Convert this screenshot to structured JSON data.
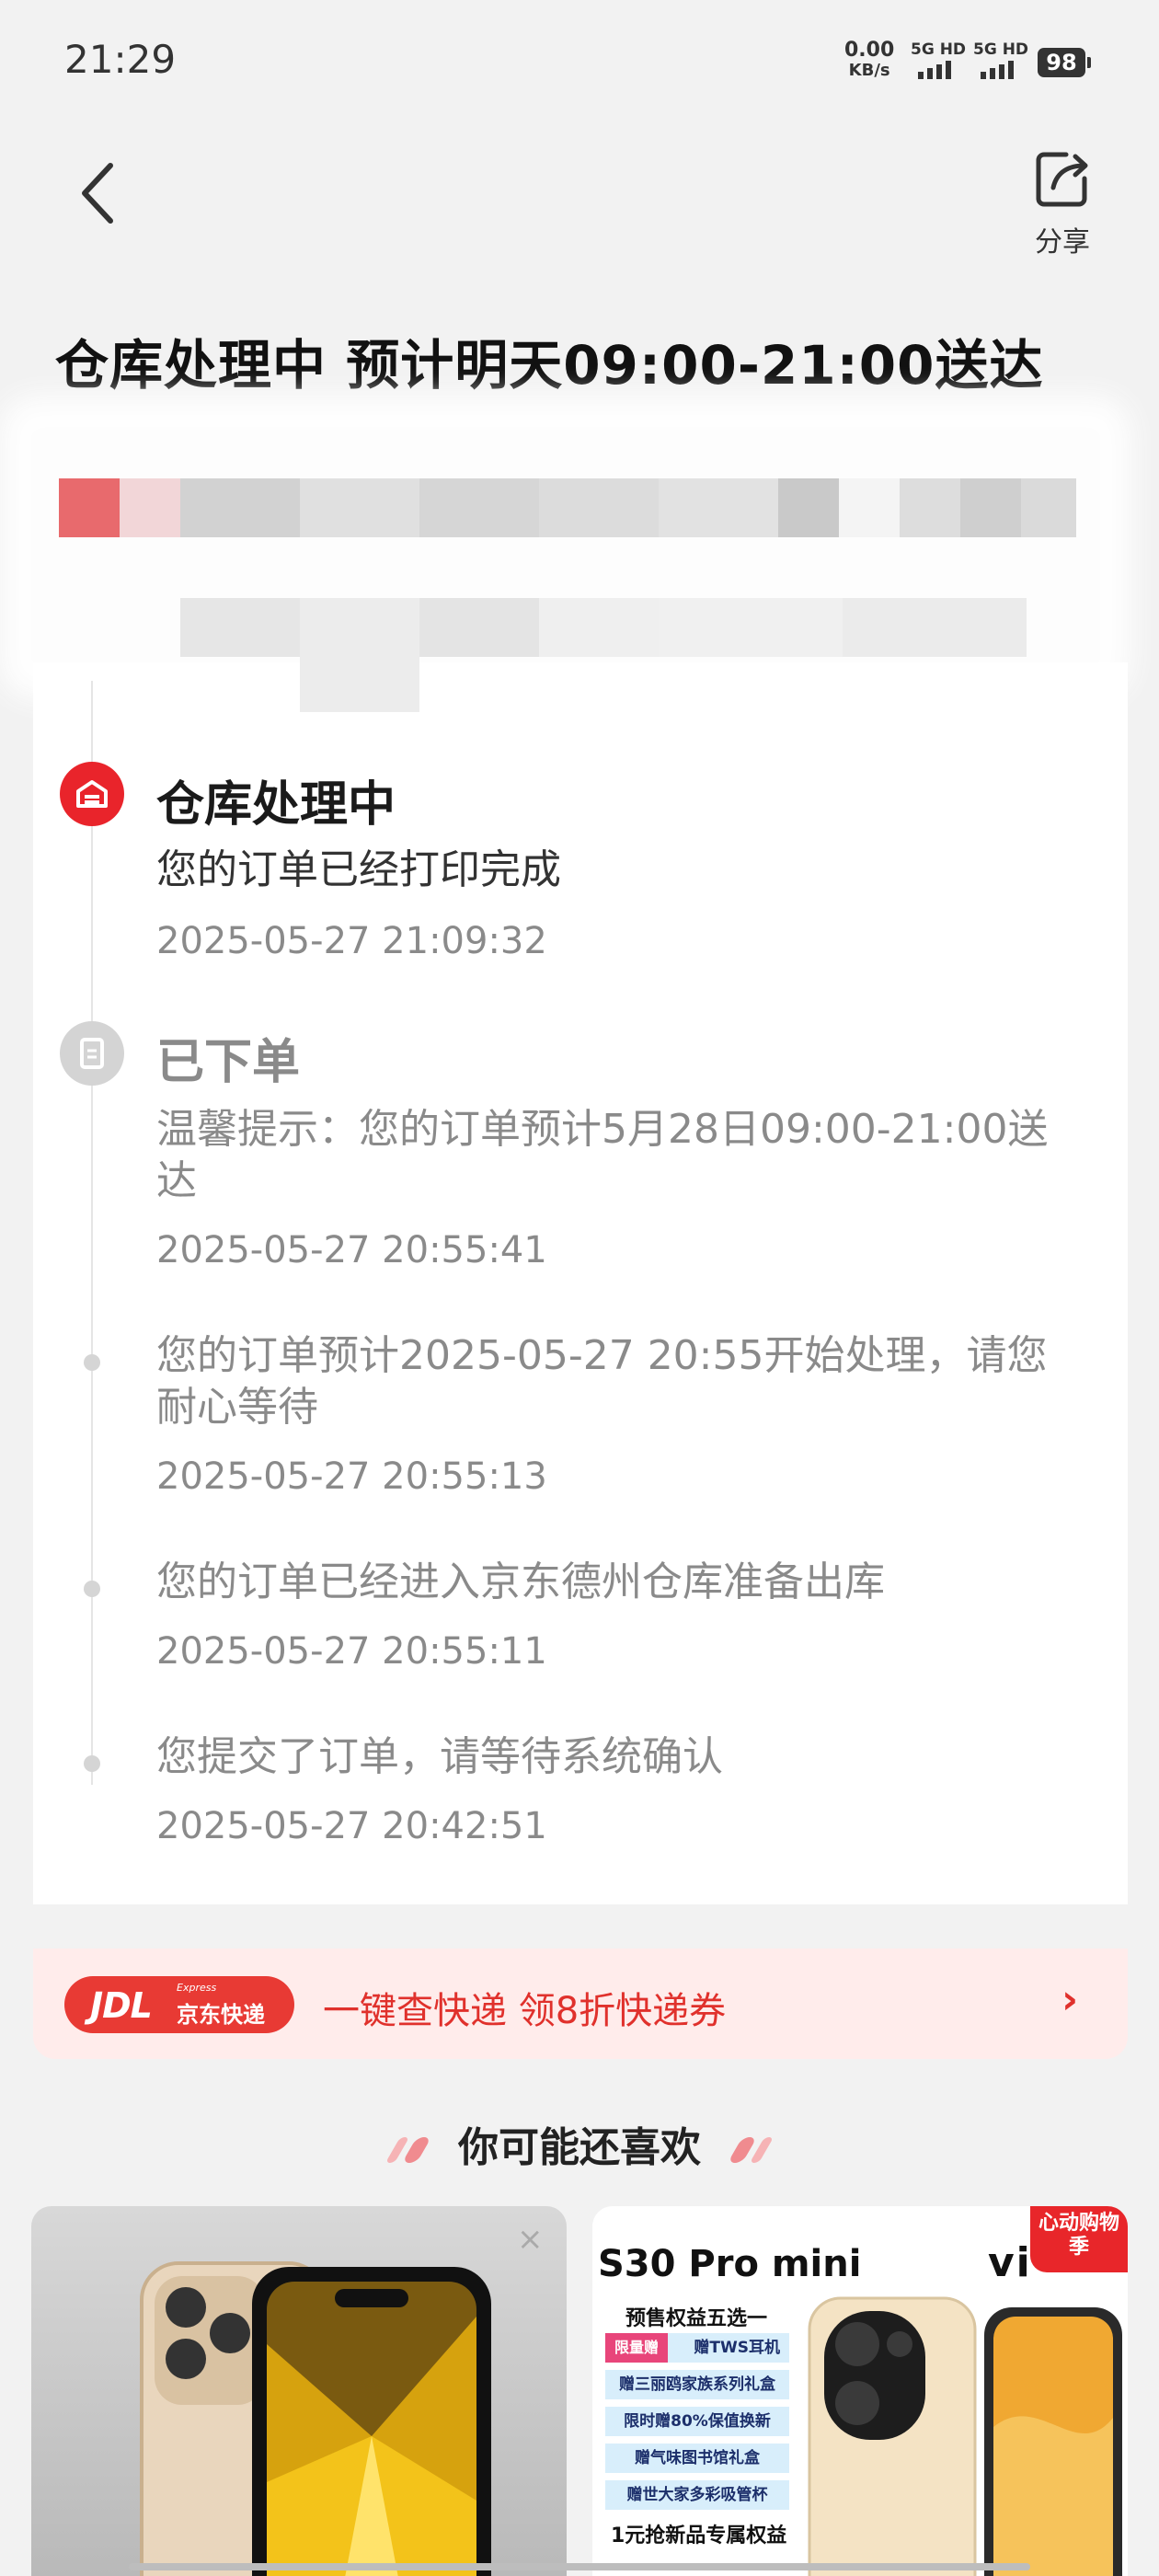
{
  "status_bar": {
    "time": "21:29",
    "net_speed": "0.00",
    "net_unit": "KB/s",
    "sim1": "5G HD",
    "sim2": "5G HD",
    "battery": "98"
  },
  "nav": {
    "share_label": "分享"
  },
  "headline": "仓库处理中 预计明天09:00-21:00送达",
  "timeline": [
    {
      "title": "仓库处理中",
      "text": "您的订单已经打印完成",
      "time": "2025-05-27 21:09:32",
      "icon": "warehouse-icon",
      "state": "active"
    },
    {
      "title": "已下单",
      "text": "温馨提示：您的订单预计5月28日09:00-21:00送达",
      "time": "2025-05-27 20:55:41",
      "icon": "order-icon",
      "state": "done"
    },
    {
      "text": "您的订单预计2025-05-27 20:55开始处理，请您耐心等待",
      "time": "2025-05-27 20:55:13",
      "state": "done"
    },
    {
      "text": "您的订单已经进入京东德州仓库准备出库",
      "time": "2025-05-27 20:55:11",
      "state": "done"
    },
    {
      "text": "您提交了订单，请等待系统确认",
      "time": "2025-05-27 20:42:51",
      "state": "done"
    }
  ],
  "promo": {
    "logo_main": "JDL",
    "logo_express": "Express",
    "logo_cn": "京东快递",
    "text": "一键查快递  领8折快递券",
    "arrow": "›"
  },
  "recommend": {
    "title": "你可能还喜欢",
    "left_close": "×",
    "right": {
      "title": "S30 Pro mini",
      "brand": "vi",
      "badge": "心动购物季",
      "head": "预售权益五选一",
      "tag": "限量赠",
      "items": [
        "赠TWS耳机",
        "赠三丽鸥家族系列礼盒",
        "限时赠80%保值换新",
        "赠气味图书馆礼盒",
        "赠世大家多彩吸管杯"
      ],
      "foot": "1元抢新品专属权益"
    }
  },
  "colors": {
    "accent": "#e9242b",
    "promo_bg": "#ffeceb",
    "grey_text": "#8a8a8a"
  }
}
